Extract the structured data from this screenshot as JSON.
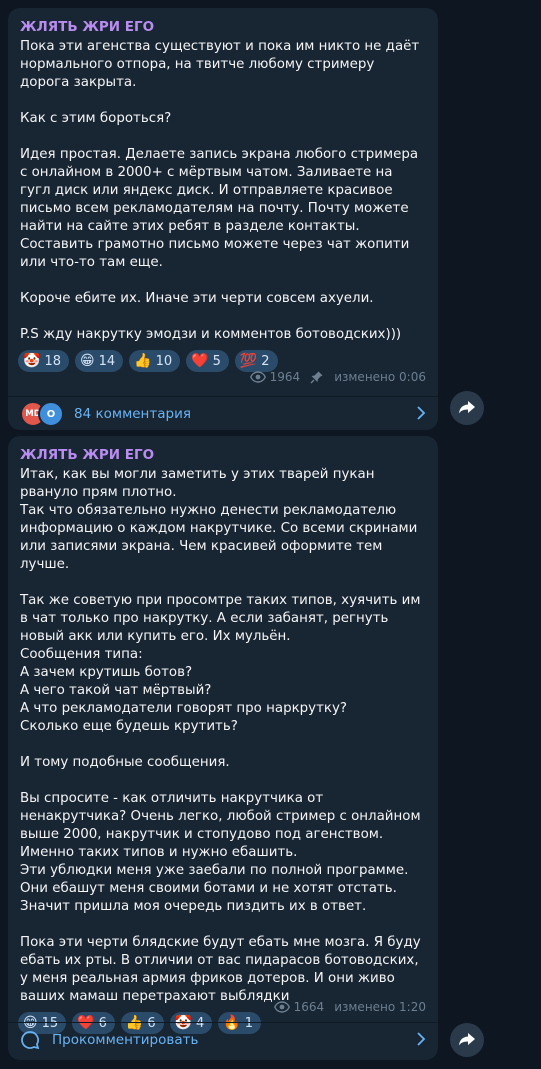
{
  "posts": [
    {
      "author": "ЖЛЯТЬ ЖРИ ЕГО",
      "text": "Пока эти агенства существуют и пока им никто не даёт нормального отпора, на твитче любому стримеру дорога закрыта.\n\nКак с этим бороться?\n\nИдея простая. Делаете запись экрана любого стримера с онлайном в 2000+ с мёртвым чатом. Заливаете на гугл диск или яндекс диск. И отправляете красивое письмо всем рекламодателям на почту. Почту можете найти на сайте этих ребят в разделе контакты.\nСоставить грамотно письмо можете через чат жопити или что-то там еще.\n\nКороче ебите их. Иначе эти черти совсем ахуели.\n\nP.S жду накрутку эмодзи и комментов ботоводских)))",
      "reactions": [
        {
          "emoji": "🤡",
          "count": "18"
        },
        {
          "emoji": "😁",
          "count": "14"
        },
        {
          "emoji": "👍",
          "count": "10"
        },
        {
          "emoji": "❤️",
          "count": "5"
        },
        {
          "emoji": "💯",
          "count": "2"
        }
      ],
      "views": "1964",
      "edited": "изменено 0:06",
      "comment_avatars": [
        "MD",
        "O"
      ],
      "comments_label": "84 комментария"
    },
    {
      "author": "ЖЛЯТЬ ЖРИ ЕГО",
      "text": "Итак, как вы могли заметить у этих тварей пукан рвануло прям плотно.\nТак что обязательно нужно денести рекламодателю информацию о каждом накрутчике. Со всеми скринами или записями экрана. Чем красивей оформите тем лучше.\n\nТак же советую при просомтре таких типов, хуячить им в чат только про накрутку. А если забанят, регнуть новый акк или купить его. Их мульён.\nСообщения типа:\nА зачем крутишь ботов?\nА чего такой чат мёртвый?\nА что рекламодатели говорят про наркрутку?\nСколько еще будешь крутить?\n\nИ тому подобные сообщения.\n\nВы спросите - как отличить накрутчика от ненакрутчика? Очень легко, любой стример с онлайном выше 2000, накрутчик и стопудово под агенством. Именно таких типов и нужно ебашить.\nЭти ублюдки меня уже заебали по полной программе. Они ебашут меня своими ботами и не хотят отстать.\nЗначит пришла моя очередь пиздить их в ответ.\n\nПока эти черти блядские будут ебать мне мозга. Я буду ебать их рты. В отличии от вас пидарасов ботоводских, у меня реальная армия фриков дотеров. И они живо ваших мамаш перетрахают выблядки",
      "reactions": [
        {
          "emoji": "😁",
          "count": "15"
        },
        {
          "emoji": "❤️",
          "count": "6"
        },
        {
          "emoji": "👍",
          "count": "6"
        },
        {
          "emoji": "🤡",
          "count": "4"
        },
        {
          "emoji": "🔥",
          "count": "1"
        }
      ],
      "views": "1664",
      "edited": "изменено 1:20",
      "comments_label": "Прокомментировать"
    }
  ],
  "icons": {
    "views": "eye-icon",
    "pinned": "pin-icon",
    "comment": "comment-bubble-icon",
    "chevron": "chevron-right-icon",
    "share": "share-arrow-icon"
  },
  "colors": {
    "background": "#0e1621",
    "bubble": "#182533",
    "author": "#b98cf0",
    "link": "#6ab3f3",
    "reaction_bg": "#2b4b6a"
  }
}
